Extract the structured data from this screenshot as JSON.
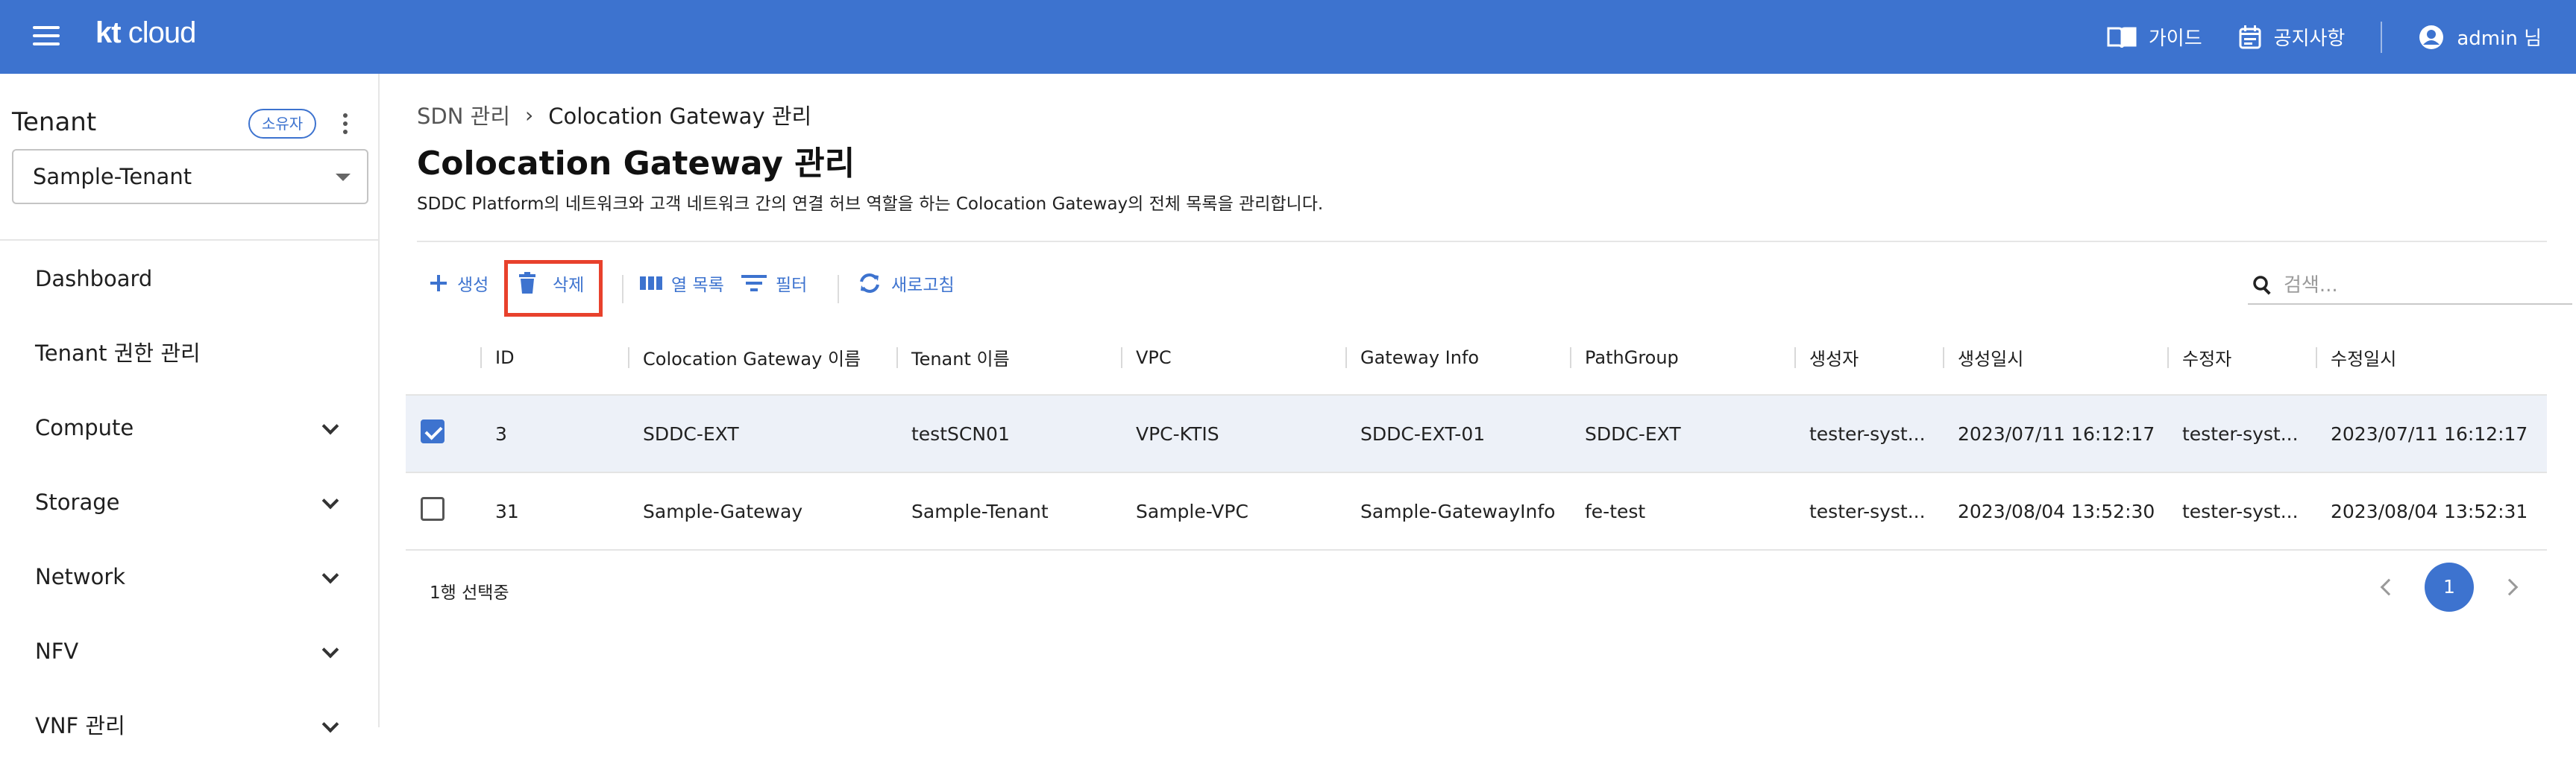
{
  "header": {
    "logo_main": "kt",
    "logo_sub": "cloud",
    "guide_label": "가이드",
    "notice_label": "공지사항",
    "user_label": "admin 님"
  },
  "sidebar": {
    "tenant_title": "Tenant",
    "owner_badge": "소유자",
    "tenant_select_value": "Sample-Tenant",
    "items": [
      {
        "label": "Dashboard",
        "expandable": false
      },
      {
        "label": "Tenant 권한 관리",
        "expandable": false
      },
      {
        "label": "Compute",
        "expandable": true
      },
      {
        "label": "Storage",
        "expandable": true
      },
      {
        "label": "Network",
        "expandable": true
      },
      {
        "label": "NFV",
        "expandable": true
      },
      {
        "label": "VNF 관리",
        "expandable": true
      }
    ]
  },
  "main": {
    "breadcrumb": [
      "SDN 관리",
      "Colocation Gateway 관리"
    ],
    "title": "Colocation Gateway 관리",
    "description": "SDDC Platform의 네트워크와 고객 네트워크 간의 연결 허브 역할을 하는 Colocation Gateway의 전체 목록을 관리합니다.",
    "toolbar": {
      "create_label": "생성",
      "delete_label": "삭제",
      "columns_label": "열 목록",
      "filter_label": "필터",
      "refresh_label": "새로고침",
      "search_placeholder": "검색..."
    },
    "table": {
      "columns": [
        "ID",
        "Colocation Gateway 이름",
        "Tenant 이름",
        "VPC",
        "Gateway Info",
        "PathGroup",
        "생성자",
        "생성일시",
        "수정자",
        "수정일시"
      ],
      "rows": [
        {
          "checked": true,
          "cells": [
            "3",
            "SDDC-EXT",
            "testSCN01",
            "VPC-KTIS",
            "SDDC-EXT-01",
            "SDDC-EXT",
            "tester-syst...",
            "2023/07/11 16:12:17",
            "tester-syst...",
            "2023/07/11 16:12:17"
          ]
        },
        {
          "checked": false,
          "cells": [
            "31",
            "Sample-Gateway",
            "Sample-Tenant",
            "Sample-VPC",
            "Sample-GatewayInfo",
            "fe-test",
            "tester-syst...",
            "2023/08/04 13:52:30",
            "tester-syst...",
            "2023/08/04 13:52:31"
          ]
        }
      ]
    },
    "footer": {
      "selection_text": "1행 선택중",
      "current_page": "1"
    }
  },
  "colors": {
    "brand": "#3d73cf",
    "highlight_box": "#e8412c",
    "selected_row": "#edf1f8"
  }
}
